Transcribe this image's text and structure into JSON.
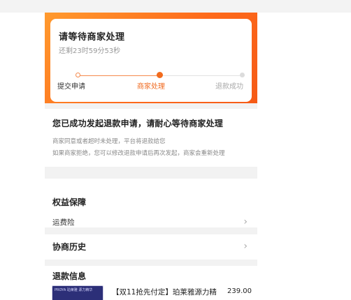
{
  "header": {
    "status_title": "请等待商家处理",
    "countdown": "还剩23时59分53秒",
    "steps": [
      "提交申请",
      "商家处理",
      "退款成功"
    ],
    "current_step": 2,
    "colors": {
      "accent": "#f26b1d",
      "gradient_start": "#ff9a2e",
      "gradient_end": "#f55a16"
    }
  },
  "notice": {
    "title": "您已成功发起退款申请，请耐心等待商家处理",
    "line1": "商家同意或者超时未处理，平台将退款给您",
    "line2": "如果商家拒绝，您可以修改退款申请后再次发起，商家会重新处理"
  },
  "sections": {
    "rights": {
      "title": "权益保障",
      "row_label": "运费险",
      "row_icon": "chevron-right-icon"
    },
    "history": {
      "title": "协商历史",
      "icon": "chevron-right-icon"
    },
    "refund_info": {
      "title": "退款信息",
      "product_name": "【双11抢先付定】珀莱雅源力精",
      "thumb_caption": "PROYA 珀莱雅 源力精华",
      "price": "239.00"
    }
  }
}
